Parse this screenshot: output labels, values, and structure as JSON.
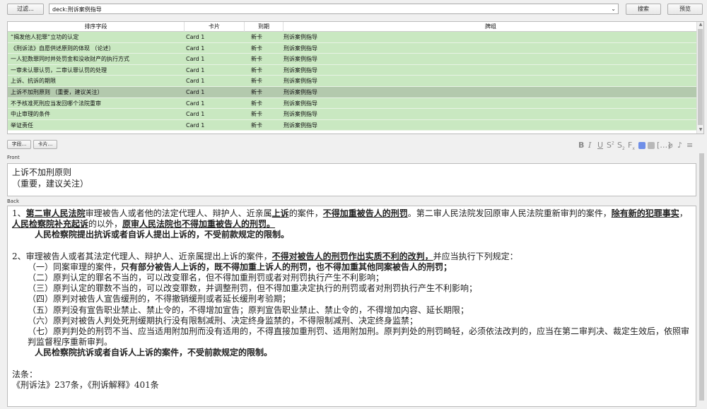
{
  "toolbar": {
    "filter_label": "过滤...",
    "search_label": "搜索",
    "preview_label": "预览"
  },
  "search": {
    "value": "deck:刑诉案例指导"
  },
  "table": {
    "headers": [
      "排序字段",
      "卡片",
      "到期",
      "牌组"
    ],
    "rows": [
      [
        "“揭发他人犯罪”立功的认定",
        "Card 1",
        "新卡",
        "刑诉案例指导"
      ],
      [
        "《刑诉法》自愿供述原则的体现 （论述）",
        "Card 1",
        "新卡",
        "刑诉案例指导"
      ],
      [
        "一人犯数罪同时并处罚金和没收财产的执行方式",
        "Card 1",
        "新卡",
        "刑诉案例指导"
      ],
      [
        "一审未认罪认罚，二审认罪认罚的处理",
        "Card 1",
        "新卡",
        "刑诉案例指导"
      ],
      [
        "上诉、抗诉的期限",
        "Card 1",
        "新卡",
        "刑诉案例指导"
      ],
      [
        "上诉不加刑原则 （重要，建议关注）",
        "Card 1",
        "新卡",
        "刑诉案例指导"
      ],
      [
        "不予核准死刑应当发回哪个法院重审",
        "Card 1",
        "新卡",
        "刑诉案例指导"
      ],
      [
        "中止审理的条件",
        "Card 1",
        "新卡",
        "刑诉案例指导"
      ],
      [
        "举证责任",
        "Card 1",
        "新卡",
        "刑诉案例指导"
      ]
    ],
    "selected_index": 5
  },
  "editor": {
    "fields_btn": "字段...",
    "cards_btn": "卡片...",
    "front_label": "Front",
    "back_label": "Back",
    "front_lines": [
      "上诉不加刑原则",
      "（重要，建议关注）"
    ]
  },
  "back": {
    "p1_a": "1、",
    "p1_b": "第二审人民法院",
    "p1_c": "审理被告人或者他的法定代理人、辩护人、近亲属",
    "p1_d": "上诉",
    "p1_e": "的案件，",
    "p1_f": "不得加重被告人的刑罚",
    "p1_g": "。第二审人民法院发回原审人民法院重新审判的案件，",
    "p1_h": "除有新的犯罪事实",
    "p1_i": "，",
    "p1_j": "人民检察院补充起诉",
    "p1_k": "的以外，",
    "p1_l": "原审人民法院也不得加重被告人的刑罚。",
    "p1_m": "人民检察院提出抗诉或者自诉人提出上诉的，不受前款规定的限制。",
    "p2_a": "2、审理被告人或者其法定代理人、辩护人、近亲属提出上诉的案件，",
    "p2_b": "不得对被告人的刑罚作出实质不利的改判，",
    "p2_c": "并应当执行下列规定：",
    "i1_a": "（一）同案审理的案件，",
    "i1_b": "只有部分被告人上诉的，既不得加重上诉人的刑罚，也不得加重其他同案被告人的刑罚；",
    "i2": "（二）原判认定的罪名不当的，可以改变罪名，但不得加重刑罚或者对刑罚执行产生不利影响；",
    "i3": "（三）原判认定的罪数不当的，可以改变罪数，并调整刑罚，但不得加重决定执行的刑罚或者对刑罚执行产生不利影响；",
    "i4": "（四）原判对被告人宣告缓刑的，不得撤销缓刑或者延长缓刑考验期；",
    "i5": "（五）原判没有宣告职业禁止、禁止令的，不得增加宣告；原判宣告职业禁止、禁止令的，不得增加内容、延长期限；",
    "i6": "（六）原判对被告人判处死刑缓期执行没有限制减刑、决定终身监禁的，不得限制减刑、决定终身监禁；",
    "i7": "（七）原判判处的刑罚不当、应当适用附加刑而没有适用的，不得直接加重刑罚、适用附加刑。原判判处的刑罚畸轻，必须依法改判的，应当在第二审判决、裁定生效后，依照审判监督程序重新审判。",
    "p3": "人民检察院抗诉或者自诉人上诉的案件，不受前款规定的限制。",
    "law_label": "法条：",
    "law_text": "《刑诉法》237条，《刑诉解释》401条"
  }
}
